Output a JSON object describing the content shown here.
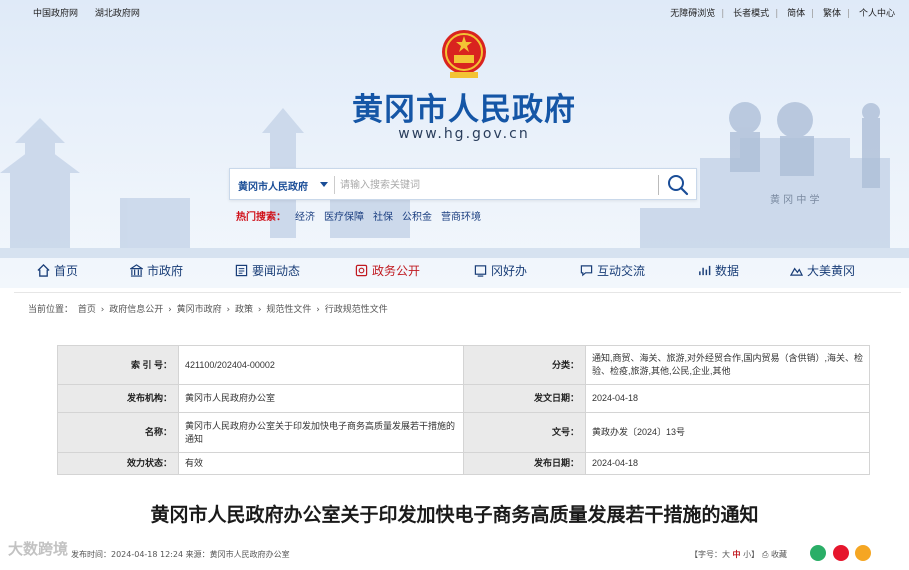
{
  "topbar": {
    "left": [
      "中国政府网",
      "湖北政府网"
    ],
    "right": [
      "无障碍浏览",
      "长者模式",
      "简体",
      "繁体",
      "个人中心"
    ]
  },
  "header": {
    "title": "黄冈市人民政府",
    "url": "www.hg.gov.cn"
  },
  "search": {
    "scope": "黄冈市人民政府",
    "placeholder": "请输入搜索关键词"
  },
  "hot": {
    "label": "热门搜索：",
    "items": [
      "经济",
      "医疗保障",
      "社保",
      "公积金",
      "营商环境"
    ]
  },
  "nav": [
    {
      "label": "首页",
      "icon": "home-icon"
    },
    {
      "label": "市政府",
      "icon": "government-building-icon"
    },
    {
      "label": "要闻动态",
      "icon": "newspaper-icon"
    },
    {
      "label": "政务公开",
      "icon": "open-affairs-icon",
      "active": true
    },
    {
      "label": "冈好办",
      "icon": "service-icon"
    },
    {
      "label": "互动交流",
      "icon": "chat-icon"
    },
    {
      "label": "数据",
      "icon": "data-chart-icon"
    },
    {
      "label": "大美黄冈",
      "icon": "scenery-icon"
    }
  ],
  "breadcrumb": {
    "prefix": "当前位置：",
    "items": [
      "首页",
      "政府信息公开",
      "黄冈市政府",
      "政策",
      "规范性文件",
      "行政规范性文件"
    ]
  },
  "meta": {
    "index_label": "索 引 号：",
    "index_value": "421100/202404-00002",
    "category_label": "分类：",
    "category_value": "通知,商贸、海关、旅游,对外经贸合作,国内贸易（含供销）,海关、检验、检疫,旅游,其他,公民,企业,其他",
    "issuer_label": "发布机构：",
    "issuer_value": "黄冈市人民政府办公室",
    "date_label": "发文日期：",
    "date_value": "2024-04-18",
    "name_label": "名称：",
    "name_value": "黄冈市人民政府办公室关于印发加快电子商务高质量发展若干措施的通知",
    "docno_label": "文号：",
    "docno_value": "黄政办发〔2024〕13号",
    "status_label": "效力状态：",
    "status_value": "有效",
    "pubdate_label": "发布日期：",
    "pubdate_value": "2024-04-18"
  },
  "doc": {
    "title": "黄冈市人民政府办公室关于印发加快电子商务高质量发展若干措施的通知",
    "info": "发布时间：2024-04-18 12:24   来源：黄冈市人民政府办公室",
    "font_prefix": "【字号：",
    "font_large": "大",
    "font_mid": "中",
    "font_small": "小】",
    "print": "收藏"
  },
  "watermark": "大数跨境",
  "colors": {
    "brand": "#1556a6",
    "accent": "#c01920"
  }
}
